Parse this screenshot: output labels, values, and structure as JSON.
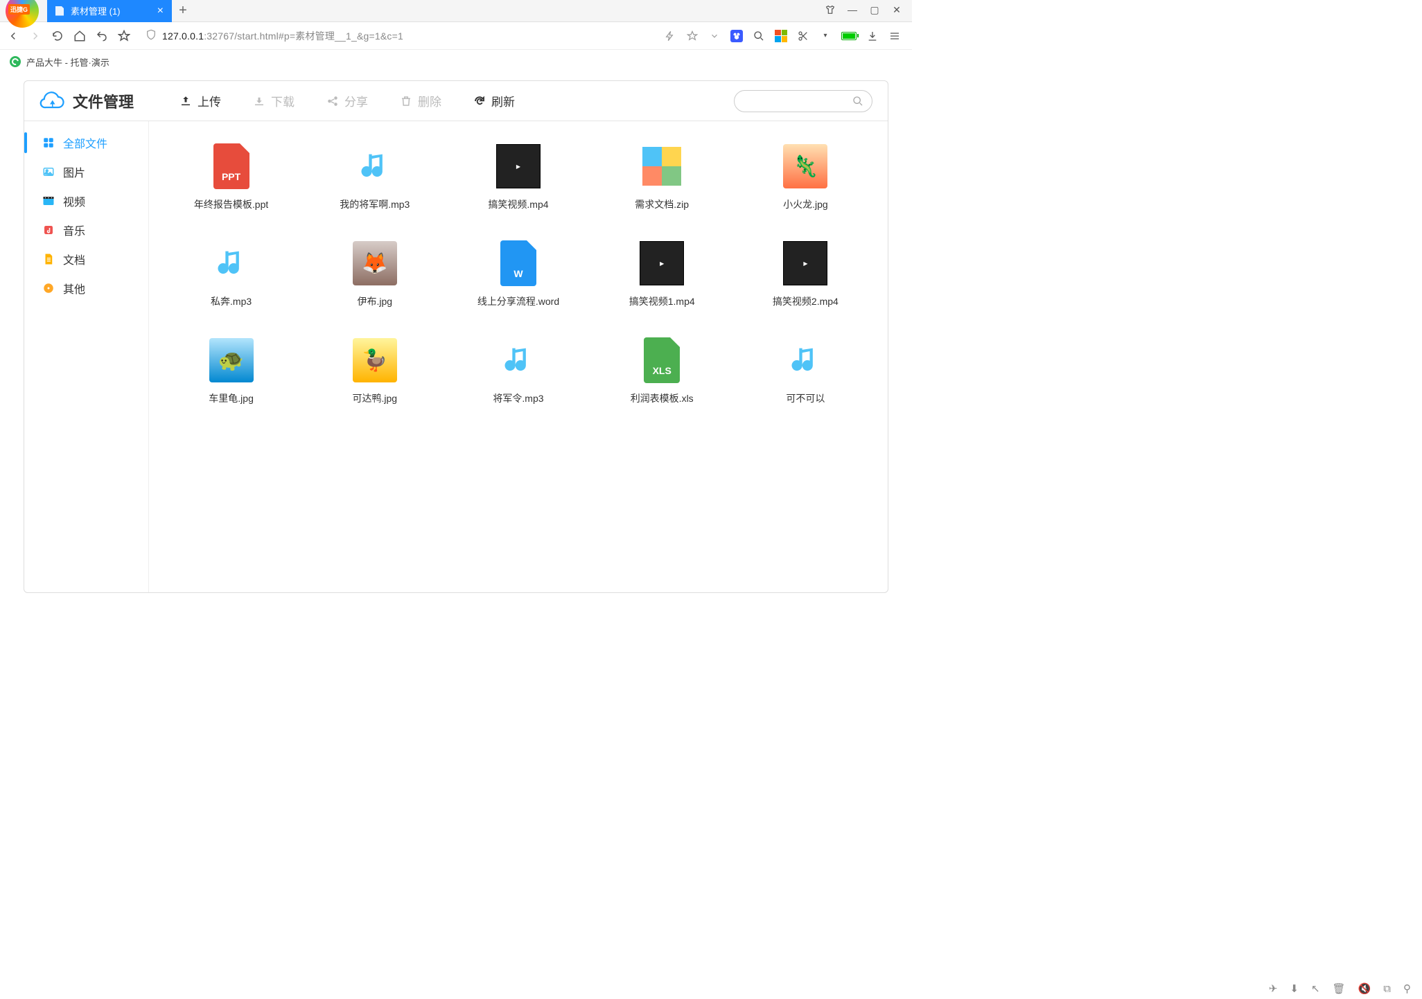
{
  "browser": {
    "app_badge": "迅捷G",
    "tab_title": "素材管理 (1)",
    "url_host": "127.0.0.1",
    "url_port": ":32767",
    "url_path": "/start.html#p=素材管理__1_&g=1&c=1",
    "bookmark": "产品大牛 - 托管·演示"
  },
  "fm": {
    "title": "文件管理",
    "actions": {
      "upload": "上传",
      "download": "下载",
      "share": "分享",
      "delete": "删除",
      "refresh": "刷新"
    },
    "sidebar": [
      {
        "label": "全部文件",
        "icon": "grid",
        "active": true,
        "color": "#1e9fff"
      },
      {
        "label": "图片",
        "icon": "image",
        "color": "#4fc3f7"
      },
      {
        "label": "视频",
        "icon": "video",
        "color": "#29b6f6"
      },
      {
        "label": "音乐",
        "icon": "music",
        "color": "#ef5350"
      },
      {
        "label": "文档",
        "icon": "doc",
        "color": "#ffb300"
      },
      {
        "label": "其他",
        "icon": "disc",
        "color": "#ffa726"
      }
    ],
    "files": [
      {
        "name": "年终报告模板.ppt",
        "type": "ppt",
        "badge": "PPT"
      },
      {
        "name": "我的将军啊.mp3",
        "type": "music"
      },
      {
        "name": "搞笑视频.mp4",
        "type": "video"
      },
      {
        "name": "需求文档.zip",
        "type": "zip"
      },
      {
        "name": "小火龙.jpg",
        "type": "img",
        "variant": "char1",
        "glyph": "🦎"
      },
      {
        "name": "私奔.mp3",
        "type": "music"
      },
      {
        "name": "伊布.jpg",
        "type": "img",
        "variant": "char2",
        "glyph": "🦊"
      },
      {
        "name": "线上分享流程.word",
        "type": "word",
        "badge": "W"
      },
      {
        "name": "搞笑视频1.mp4",
        "type": "video"
      },
      {
        "name": "搞笑视频2.mp4",
        "type": "video"
      },
      {
        "name": "车里龟.jpg",
        "type": "img",
        "variant": "char3",
        "glyph": "🐢"
      },
      {
        "name": "可达鸭.jpg",
        "type": "img",
        "variant": "char4",
        "glyph": "🦆"
      },
      {
        "name": "将军令.mp3",
        "type": "music"
      },
      {
        "name": "利润表模板.xls",
        "type": "xls",
        "badge": "XLS"
      },
      {
        "name": "可不可以",
        "type": "music"
      }
    ]
  }
}
